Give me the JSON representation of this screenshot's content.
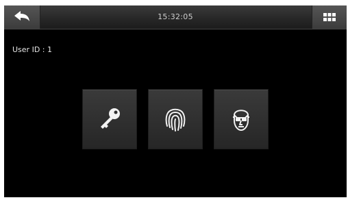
{
  "header": {
    "time": "15:32:05",
    "back_icon": "back-arrow-icon",
    "menu_icon": "grid-menu-icon"
  },
  "main": {
    "user_id_text": "User ID : 1",
    "verify_options": [
      {
        "name": "password",
        "icon": "key-icon"
      },
      {
        "name": "fingerprint",
        "icon": "fingerprint-icon"
      },
      {
        "name": "face",
        "icon": "face-icon"
      }
    ]
  },
  "colors": {
    "background": "#000000",
    "bar": "#2a2a2a",
    "text": "#e6e6e6"
  }
}
